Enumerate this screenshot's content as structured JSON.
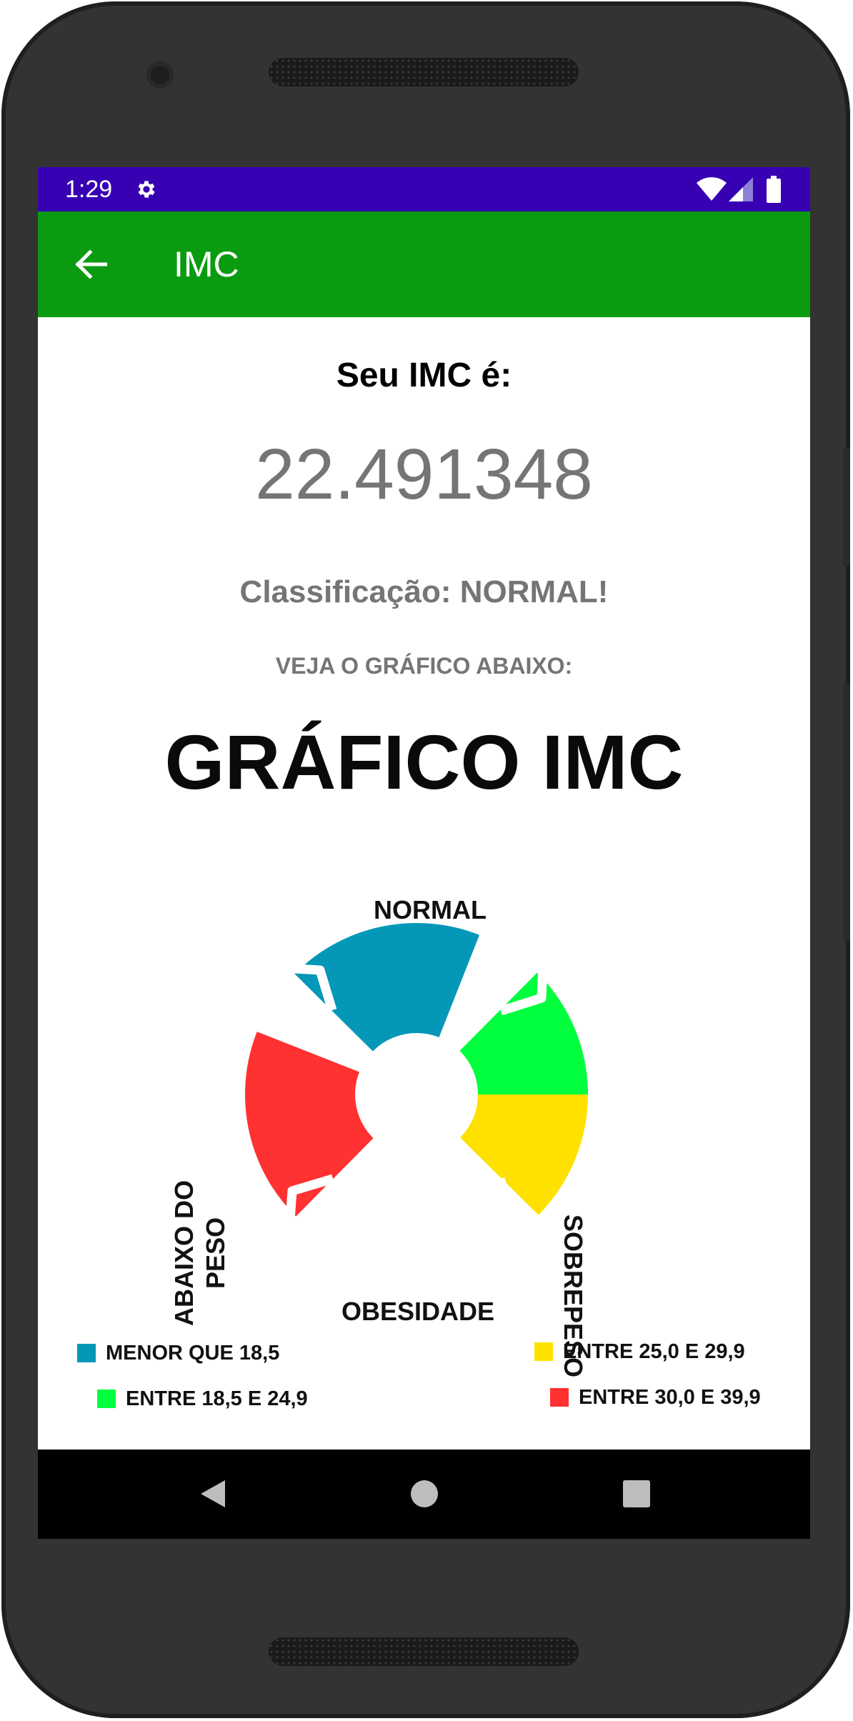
{
  "status_bar": {
    "time": "1:29",
    "background": "#3700b3"
  },
  "app_bar": {
    "title": "IMC",
    "background": "#0b9b10",
    "back_icon": "arrow-left-icon"
  },
  "result": {
    "heading": "Seu IMC é:",
    "value": "22.491348",
    "classification": "Classificação: NORMAL!",
    "instruction": "VEJA O GRÁFICO ABAIXO:"
  },
  "chart_image": {
    "title": "GRÁFICO IMC",
    "segment_labels": {
      "normal": "NORMAL",
      "sobrepeso": "SOBREPESO",
      "obesidade": "OBESIDADE",
      "abaixo_line1": "ABAIXO DO",
      "abaixo_line2": "PESO"
    },
    "legend": [
      {
        "label": "MENOR QUE 18,5",
        "color": "#0497b8"
      },
      {
        "label": "ENTRE 25,0 E 29,9",
        "color": "#ffe100"
      },
      {
        "label": "ENTRE 18,5 E 24,9",
        "color": "#00ff3d"
      },
      {
        "label": "ENTRE 30,0 E 39,9",
        "color": "#ff3131"
      }
    ]
  },
  "nav_bar": {
    "icons": [
      "back-triangle-icon",
      "home-circle-icon",
      "recents-square-icon"
    ]
  }
}
